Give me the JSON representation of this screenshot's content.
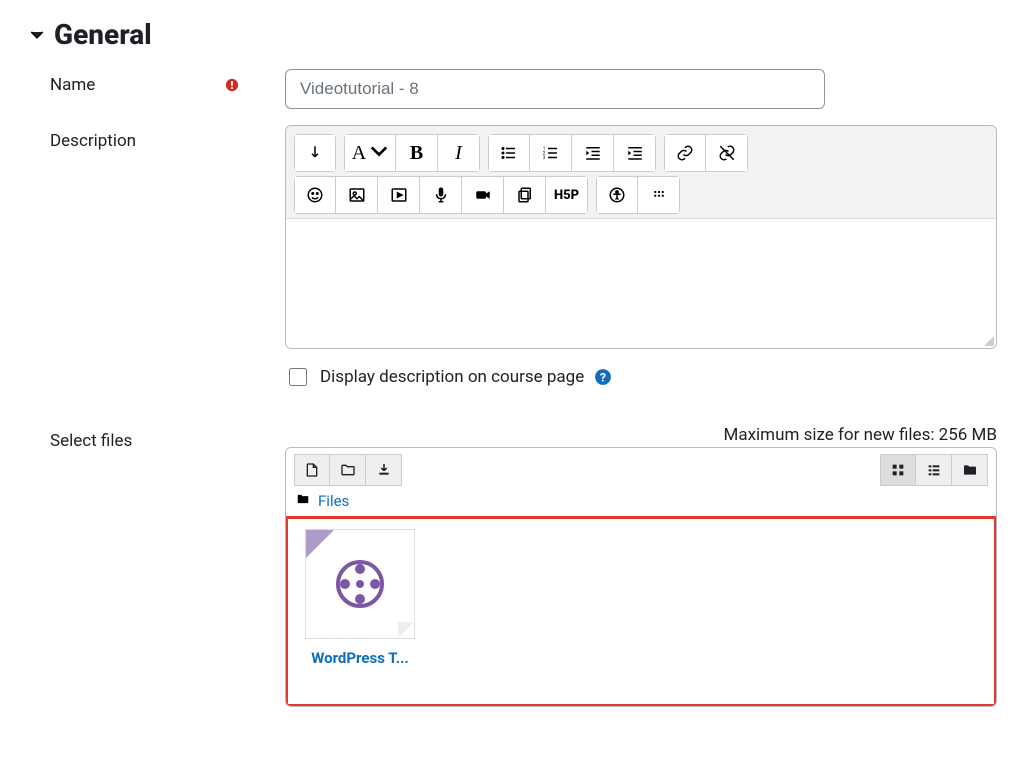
{
  "section": {
    "title": "General"
  },
  "name": {
    "label": "Name",
    "value": "Videotutorial - 8"
  },
  "description": {
    "label": "Description",
    "display_checkbox_label": "Display description on course page",
    "toolbar": {
      "expand": "Show more buttons",
      "styles": "A",
      "bold": "B",
      "italic": "I"
    }
  },
  "select_files": {
    "label": "Select files",
    "max_text": "Maximum size for new files: 256 MB",
    "breadcrumb_root": "Files",
    "file": {
      "name": "WordPress T..."
    }
  }
}
